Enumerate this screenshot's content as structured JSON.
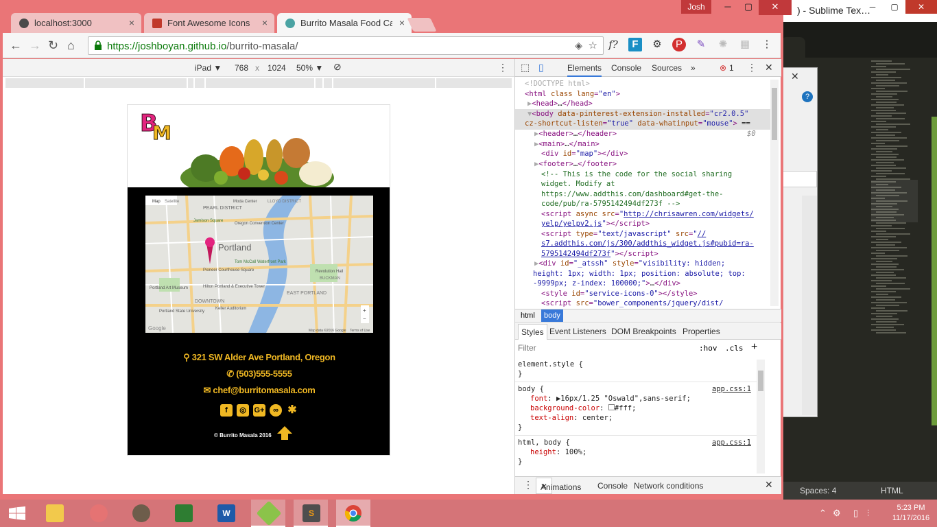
{
  "sublime": {
    "title": ") - Sublime Tex…",
    "status_spaces": "Spaces: 4",
    "status_syntax": "HTML"
  },
  "chrome": {
    "user": "Josh",
    "tabs": [
      {
        "label": "localhost:3000"
      },
      {
        "label": "Font Awesome Icons"
      },
      {
        "label": "Burrito Masala Food Cart"
      }
    ],
    "url_host": "https://joshboyan.github.io",
    "url_path": "/burrito-masala/"
  },
  "device_bar": {
    "device": "iPad ▼",
    "width": "768",
    "times": "x",
    "height": "1024",
    "zoom": "50% ▼"
  },
  "site": {
    "logo_text": "BM",
    "address": "321 SW Alder Ave Portland, Oregon",
    "phone": "(503)555-5555",
    "email": "chef@burritomasala.com",
    "copyright": "© Burrito Masala 2016",
    "map_labels": [
      "Map",
      "Satellite",
      "PEARL DISTRICT",
      "Moda Center",
      "LLOYD DISTRICT",
      "Oregon Convention Center",
      "Jamison Square",
      "Portland",
      "Tom McCall Waterfront Park",
      "Pioneer Courthouse Square",
      "Revolution Hall",
      "BUCKMAN",
      "Hilton Portland & Executive Tower",
      "EAST PORTLAND",
      "Portland Art Museum",
      "DOWNTOWN",
      "Portland State University",
      "Keller Auditorium",
      "Google",
      "Map data ©2016 Google",
      "Terms of Use"
    ]
  },
  "devtools": {
    "tabs": [
      "Elements",
      "Console",
      "Sources",
      "»"
    ],
    "error_count": "1",
    "breadcrumbs": [
      "html",
      "body"
    ],
    "subtabs": [
      "Styles",
      "Event Listeners",
      "DOM Breakpoints",
      "Properties"
    ],
    "filter_placeholder": "Filter",
    "hov": ":hov",
    "cls": ".cls",
    "drawer_tabs": [
      "Animations",
      "Console",
      "Network conditions"
    ]
  },
  "taskbar": {
    "time": "5:23 PM",
    "date": "11/17/2016"
  }
}
